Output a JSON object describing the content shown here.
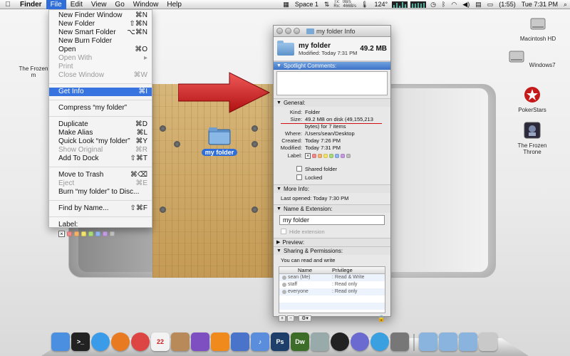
{
  "menubar": {
    "app_name": "Finder",
    "menus": [
      "File",
      "Edit",
      "View",
      "Go",
      "Window",
      "Help"
    ],
    "space": "Space 1",
    "net_tx": "0B/s",
    "net_rx": "466B/s",
    "net_tx_label": "Tx:",
    "net_rx_label": "Rx:",
    "temperature": "124°",
    "battery": "(1:55)",
    "clock": "Tue 7:31 PM"
  },
  "file_menu": {
    "items": [
      {
        "label": "New Finder Window",
        "shortcut": "⌘N",
        "disabled": false
      },
      {
        "label": "New Folder",
        "shortcut": "⇧⌘N",
        "disabled": false
      },
      {
        "label": "New Smart Folder",
        "shortcut": "⌥⌘N",
        "disabled": false
      },
      {
        "label": "New Burn Folder",
        "shortcut": "",
        "disabled": false
      },
      {
        "label": "Open",
        "shortcut": "⌘O",
        "disabled": false
      },
      {
        "label": "Open With",
        "shortcut": "▸",
        "disabled": true
      },
      {
        "label": "Print",
        "shortcut": "",
        "disabled": true
      },
      {
        "label": "Close Window",
        "shortcut": "⌘W",
        "disabled": true
      },
      {
        "label": "Get Info",
        "shortcut": "⌘I",
        "disabled": false
      },
      {
        "label": "Compress “my folder”",
        "shortcut": "",
        "disabled": false
      },
      {
        "label": "Duplicate",
        "shortcut": "⌘D",
        "disabled": false
      },
      {
        "label": "Make Alias",
        "shortcut": "⌘L",
        "disabled": false
      },
      {
        "label": "Quick Look “my folder”",
        "shortcut": "⌘Y",
        "disabled": false
      },
      {
        "label": "Show Original",
        "shortcut": "⌘R",
        "disabled": true
      },
      {
        "label": "Add To Dock",
        "shortcut": "⇧⌘T",
        "disabled": false
      },
      {
        "label": "Move to Trash",
        "shortcut": "⌘⌫",
        "disabled": false
      },
      {
        "label": "Eject",
        "shortcut": "⌘E",
        "disabled": true
      },
      {
        "label": "Burn “my folder” to Disc...",
        "shortcut": "",
        "disabled": false
      },
      {
        "label": "Find by Name...",
        "shortcut": "⇧⌘F",
        "disabled": false
      }
    ],
    "label_title": "Label:",
    "label_colors": [
      "#f08a8a",
      "#f4b36b",
      "#f2e36a",
      "#a9d97a",
      "#8fb4ee",
      "#c49ae0",
      "#bdbdbd"
    ]
  },
  "info_window": {
    "title": "my folder Info",
    "name": "my folder",
    "size_header": "49.2 MB",
    "modified_header": "Modified: Today 7:31 PM",
    "spotlight_title": "Spotlight Comments:",
    "general_title": "General:",
    "general": {
      "kind_label": "Kind:",
      "kind": "Folder",
      "size_label": "Size:",
      "size": "49.2 MB on disk (49,155,213",
      "size_cont": "bytes) for 7 items",
      "where_label": "Where:",
      "where": "/Users/sean/Desktop",
      "created_label": "Created:",
      "created": "Today 7:26 PM",
      "modified_label": "Modified:",
      "modified": "Today 7:31 PM",
      "label_label": "Label:"
    },
    "shared_folder": "Shared folder",
    "locked": "Locked",
    "more_info_title": "More Info:",
    "last_opened": "Last opened: Today 7:30 PM",
    "name_ext_title": "Name & Extension:",
    "name_field_value": "my folder",
    "hide_extension": "Hide extension",
    "preview_title": "Preview:",
    "sharing_title": "Sharing & Permissions:",
    "sharing_text": "You can read and write",
    "perm_col_name": "Name",
    "perm_col_priv": "Privilege",
    "permissions": [
      {
        "name": "sean (Me)",
        "priv": "Read & Write"
      },
      {
        "name": "staff",
        "priv": "Read only"
      },
      {
        "name": "everyone",
        "priv": "Read only"
      }
    ],
    "label_colors": [
      "#f08a8a",
      "#f4b36b",
      "#f2e36a",
      "#a9d97a",
      "#8fb4ee",
      "#c49ae0",
      "#bdbdbd"
    ]
  },
  "desktop": {
    "folder_label": "my folder",
    "left_icon_label": "The Frozen",
    "left_icon_label2": "m",
    "icons": [
      "Macintosh HD",
      "Windows7",
      "PokerStars",
      "The Frozen Throne"
    ]
  },
  "dock": {
    "apps": [
      {
        "name": "finder-icon",
        "color": "#4a8fe0",
        "text": ""
      },
      {
        "name": "terminal-icon",
        "color": "#222222",
        "text": ">_"
      },
      {
        "name": "safari-icon",
        "color": "#3a9be8",
        "text": ""
      },
      {
        "name": "firefox-icon",
        "color": "#e87b22",
        "text": ""
      },
      {
        "name": "chrome-icon",
        "color": "#d44",
        "text": ""
      },
      {
        "name": "ical-icon",
        "color": "#f2f2f2",
        "text": "22"
      },
      {
        "name": "library-icon",
        "color": "#b88a5a",
        "text": ""
      },
      {
        "name": "kaboom-icon",
        "color": "#7d4fc1",
        "text": ""
      },
      {
        "name": "vlc-icon",
        "color": "#f08a1c",
        "text": ""
      },
      {
        "name": "xcode-icon",
        "color": "#4a74c9",
        "text": ""
      },
      {
        "name": "itunes-icon",
        "color": "#5a8edc",
        "text": "♪"
      },
      {
        "name": "photoshop-icon",
        "color": "#1e3f6a",
        "text": "Ps"
      },
      {
        "name": "dreamweaver-icon",
        "color": "#3c6e2a",
        "text": "Dw"
      },
      {
        "name": "hardware-icon",
        "color": "#9aa",
        "text": ""
      },
      {
        "name": "qq-icon",
        "color": "#222",
        "text": ""
      },
      {
        "name": "globe-icon",
        "color": "#6a6ad0",
        "text": ""
      },
      {
        "name": "quicktime-icon",
        "color": "#3aa0e0",
        "text": ""
      },
      {
        "name": "preferences-icon",
        "color": "#777",
        "text": ""
      }
    ],
    "stacks": [
      {
        "name": "applications-stack-icon",
        "color": "#8ab4de"
      },
      {
        "name": "documents-stack-icon",
        "color": "#8ab4de"
      },
      {
        "name": "downloads-stack-icon",
        "color": "#8ab4de"
      },
      {
        "name": "trash-icon",
        "color": "#c9c9c9"
      }
    ]
  }
}
